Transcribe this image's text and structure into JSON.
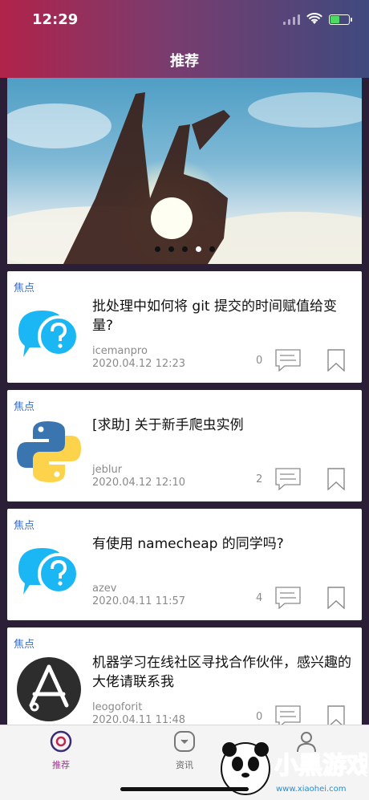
{
  "status_bar": {
    "time": "12:29"
  },
  "nav": {
    "title": "推荐"
  },
  "banner": {
    "dots": 5,
    "active_dot": 4
  },
  "posts": [
    {
      "tag": "焦点",
      "title": "批处理中如何将 git 提交的时间赋值给变量?",
      "author": "icemanpro",
      "date": "2020.04.12 12:23",
      "comments": "0",
      "thumb": "question-bubble-icon"
    },
    {
      "tag": "焦点",
      "title": "[求助] 关于新手爬虫实例",
      "author": "jeblur",
      "date": "2020.04.12 12:10",
      "comments": "2",
      "thumb": "python-logo-icon"
    },
    {
      "tag": "焦点",
      "title": "有使用 namecheap 的同学吗?",
      "author": "azev",
      "date": "2020.04.11 11:57",
      "comments": "4",
      "thumb": "question-bubble-icon"
    },
    {
      "tag": "焦点",
      "title": "机器学习在线社区寻找合作伙伴，感兴趣的大佬请联系我",
      "author": "leogoforit",
      "date": "2020.04.11 11:48",
      "comments": "0",
      "thumb": "app-store-icon"
    }
  ],
  "tabbar": {
    "tabs": [
      {
        "label": "推荐",
        "icon": "recommend-icon",
        "active": true
      },
      {
        "label": "资讯",
        "icon": "news-icon",
        "active": false
      },
      {
        "label": "",
        "icon": "profile-icon",
        "active": false
      }
    ]
  },
  "watermark": {
    "text": "小黑游戏",
    "url_text": "www.xiaohei.com"
  },
  "colors": {
    "accent": "#9b3c8a",
    "tag": "#3a6fc7",
    "header_start": "#b0234a",
    "header_end": "#3f4a7f"
  }
}
